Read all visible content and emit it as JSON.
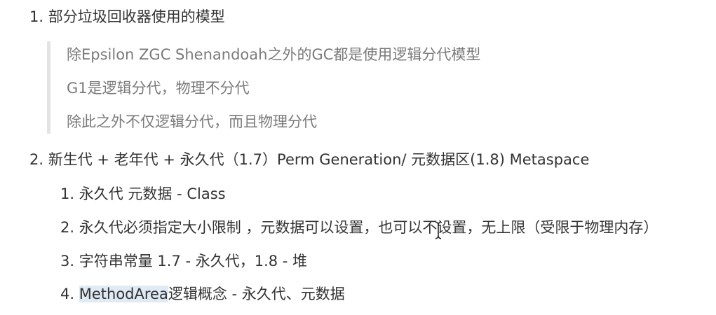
{
  "item1": {
    "number": "1.",
    "text": "部分垃圾回收器使用的模型",
    "quote": [
      "除Epsilon ZGC Shenandoah之外的GC都是使用逻辑分代模型",
      "G1是逻辑分代，物理不分代",
      "除此之外不仅逻辑分代，而且物理分代"
    ]
  },
  "item2": {
    "number": "2.",
    "text": "新生代 + 老年代 + 永久代（1.7）Perm Generation/ 元数据区(1.8) Metaspace",
    "sub": [
      {
        "number": "1.",
        "text": "永久代 元数据 - Class"
      },
      {
        "number": "2.",
        "text": "永久代必须指定大小限制 ，元数据可以设置，也可以不设置，无上限（受限于物理内存）"
      },
      {
        "number": "3.",
        "text": "字符串常量 1.7 - 永久代，1.8 - 堆"
      },
      {
        "number": "4.",
        "highlight": "MethodArea",
        "text": "逻辑概念 - 永久代、元数据"
      }
    ]
  }
}
